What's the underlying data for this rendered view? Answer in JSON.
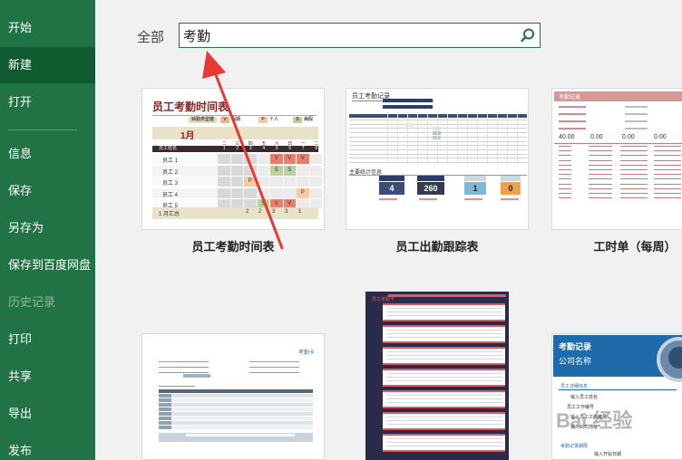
{
  "sidebar": {
    "items": [
      {
        "label": "开始"
      },
      {
        "label": "新建"
      },
      {
        "label": "打开"
      },
      {
        "label": "信息"
      },
      {
        "label": "保存"
      },
      {
        "label": "另存为"
      },
      {
        "label": "保存到百度网盘"
      },
      {
        "label": "历史记录"
      },
      {
        "label": "打印"
      },
      {
        "label": "共享"
      },
      {
        "label": "导出"
      },
      {
        "label": "发布"
      }
    ]
  },
  "filter": {
    "label": "全部"
  },
  "search": {
    "value": "考勤"
  },
  "templates": [
    {
      "title": "员工考勤时间表",
      "preview": {
        "heading": "员工考勤时间表",
        "legend": [
          "缺勤类型键",
          "V",
          "假期",
          "P",
          "个人",
          "S",
          "病假"
        ],
        "month": "1月",
        "weekdays": [
          "二",
          "三",
          "四",
          "五",
          "六",
          "日",
          "一",
          "二"
        ],
        "days": [
          "1",
          "2",
          "3",
          "4",
          "5",
          "6",
          "7",
          "8"
        ],
        "name_header": "员工姓名",
        "employees": [
          "员工 1",
          "员工 2",
          "员工 3",
          "员工 4",
          "员工 5"
        ],
        "summary_label": "1 月汇总",
        "summary_values": [
          "2",
          "2",
          "3",
          "3",
          "1"
        ]
      }
    },
    {
      "title": "员工出勤跟踪表",
      "preview": {
        "heading": "员工考勤记录",
        "stats_heading": "主要统计信息",
        "stats": [
          "4",
          "260",
          "1",
          "0"
        ]
      }
    },
    {
      "title": "工时单（每周）",
      "preview": {
        "heading": "考勤记录",
        "values": [
          "40.00",
          "0.00",
          "0.00",
          "0.00"
        ]
      }
    },
    {
      "title": "",
      "preview": {
        "heading": "考勤卡"
      }
    },
    {
      "title": "",
      "preview": {
        "heading": "员工考勤卡"
      }
    },
    {
      "title": "",
      "preview": {
        "heading": "考勤记录",
        "subheading": "公司名称",
        "section": "员工详细信息",
        "fields": [
          "输入员工姓名",
          "员工工作编号",
          "输入员工工作编号",
          "输入公司地址"
        ],
        "footer": "考勤记录期限",
        "footer_field": "输入开始日期"
      }
    }
  ],
  "watermark": "Bai 经验",
  "colors": {
    "accent": "#217346",
    "arrow": "#e53935"
  }
}
